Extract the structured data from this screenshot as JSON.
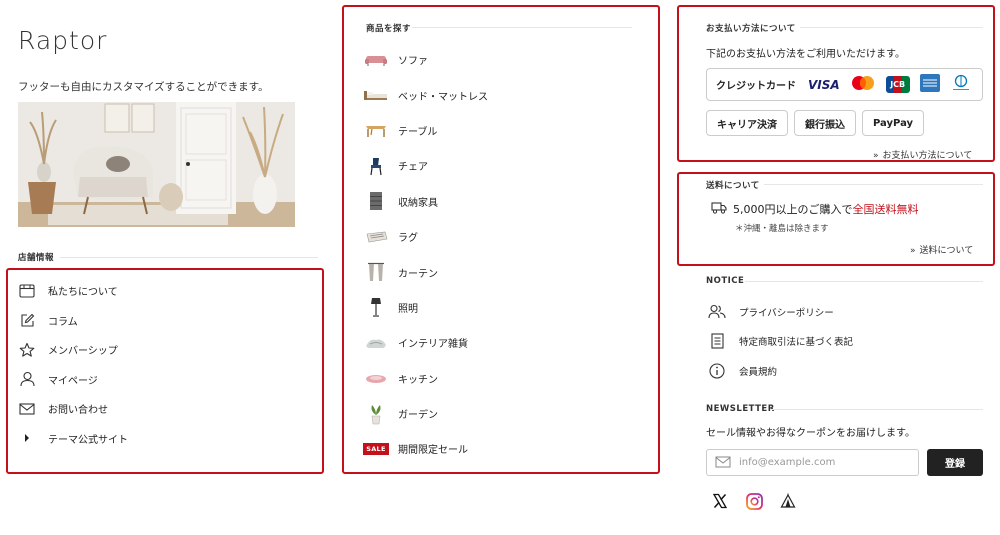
{
  "brand": {
    "logo": "Raptor",
    "tagline": "フッターも自由にカスタマイズすることができます。"
  },
  "store_info": {
    "title": "店舗情報",
    "items": [
      {
        "label": "私たちについて",
        "icon": "store-icon"
      },
      {
        "label": "コラム",
        "icon": "edit-icon"
      },
      {
        "label": "メンバーシップ",
        "icon": "star-icon"
      },
      {
        "label": "マイページ",
        "icon": "user-icon"
      },
      {
        "label": "お問い合わせ",
        "icon": "mail-icon"
      },
      {
        "label": "テーマ公式サイト",
        "icon": "caret-right-icon"
      }
    ]
  },
  "categories": {
    "title": "商品を探す",
    "items": [
      {
        "label": "ソファ",
        "icon": "sofa-thumb"
      },
      {
        "label": "ベッド・マットレス",
        "icon": "bed-thumb"
      },
      {
        "label": "テーブル",
        "icon": "table-thumb"
      },
      {
        "label": "チェア",
        "icon": "chair-thumb"
      },
      {
        "label": "収納家具",
        "icon": "storage-thumb"
      },
      {
        "label": "ラグ",
        "icon": "rug-thumb"
      },
      {
        "label": "カーテン",
        "icon": "curtain-thumb"
      },
      {
        "label": "照明",
        "icon": "lamp-thumb"
      },
      {
        "label": "インテリア雑貨",
        "icon": "interior-thumb"
      },
      {
        "label": "キッチン",
        "icon": "kitchen-thumb"
      },
      {
        "label": "ガーデン",
        "icon": "garden-thumb"
      },
      {
        "label": "期間限定セール",
        "icon": "sale-thumb",
        "badge": "SALE"
      }
    ]
  },
  "payment": {
    "title": "お支払い方法について",
    "description": "下記のお支払い方法をご利用いただけます。",
    "card_label": "クレジットカード",
    "card_brands": {
      "visa": "VISA",
      "jcb": "JCB"
    },
    "options": [
      "キャリア決済",
      "銀行振込",
      "PayPay"
    ],
    "link": "お支払い方法について"
  },
  "shipping": {
    "title": "送料について",
    "main_prefix": "5,000円以上のご購入で",
    "main_highlight": "全国送料無料",
    "note": "＊沖縄・離島は除きます",
    "link": "送料について"
  },
  "notice": {
    "title": "NOTICE",
    "items": [
      {
        "label": "プライバシーポリシー",
        "icon": "users-icon"
      },
      {
        "label": "特定商取引法に基づく表記",
        "icon": "document-icon"
      },
      {
        "label": "会員規約",
        "icon": "info-icon"
      }
    ]
  },
  "newsletter": {
    "title": "NEWSLETTER",
    "description": "セール情報やお得なクーポンをお届けします。",
    "placeholder": "info@example.com",
    "button": "登録"
  },
  "social": [
    "x-icon",
    "instagram-icon",
    "tent-icon"
  ],
  "colors": {
    "accent_red": "#c4101b",
    "button_dark": "#222222"
  }
}
